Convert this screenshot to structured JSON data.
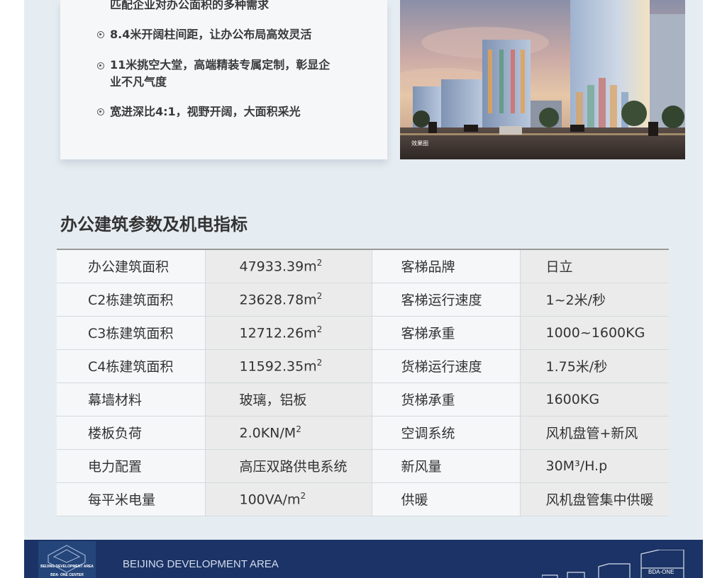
{
  "features": {
    "partial_line": "匹配企业对办公面积的多种需求",
    "items": [
      "8.4米开阔柱间距，让办公布局高效灵活",
      "11米挑空大堂，高端精装专属定制，彰显企",
      "业不凡气度",
      "宽进深比4:1，视野开阔，大面积采光"
    ]
  },
  "render": {
    "caption": "效果图"
  },
  "section_title": "办公建筑参数及机电指标",
  "spec_table": {
    "rows": [
      {
        "label1": "办公建筑面积",
        "value1": "47933.39m",
        "sup1": "2",
        "label2": "客梯品牌",
        "value2": "日立"
      },
      {
        "label1": "C2栋建筑面积",
        "value1": "23628.78m",
        "sup1": "2",
        "label2": "客梯运行速度",
        "value2": "1~2米/秒"
      },
      {
        "label1": "C3栋建筑面积",
        "value1": "12712.26m",
        "sup1": "2",
        "label2": "客梯承重",
        "value2": "1000~1600KG"
      },
      {
        "label1": "C4栋建筑面积",
        "value1": "11592.35m",
        "sup1": "2",
        "label2": "货梯运行速度",
        "value2": "1.75米/秒"
      },
      {
        "label1": "幕墙材料",
        "value1": "玻璃，铝板",
        "sup1": "",
        "label2": "货梯承重",
        "value2": "1600KG"
      },
      {
        "label1": "楼板负荷",
        "value1": "2.0KN/M",
        "sup1": "2",
        "label2": "空调系统",
        "value2": "风机盘管+新风"
      },
      {
        "label1": "电力配置",
        "value1": "高压双路供电系统",
        "sup1": "",
        "label2": "新风量",
        "value2": "30M³/H.p"
      },
      {
        "label1": "每平米电量",
        "value1": "100VA/m",
        "sup1": "2",
        "label2": "供暖",
        "value2": "风机盘管集中供暖"
      }
    ]
  },
  "footer": {
    "logo_line1": "BEIJING DEVELOPMENT AREA",
    "logo_line2": "BDA· ONE  CENTER",
    "text": "BEIJING DEVELOPMENT AREA",
    "brand": "BDA-ONE"
  },
  "colors": {
    "panel": "#e6edf2",
    "footer": "#1b3366",
    "accent_text": "#333333"
  }
}
